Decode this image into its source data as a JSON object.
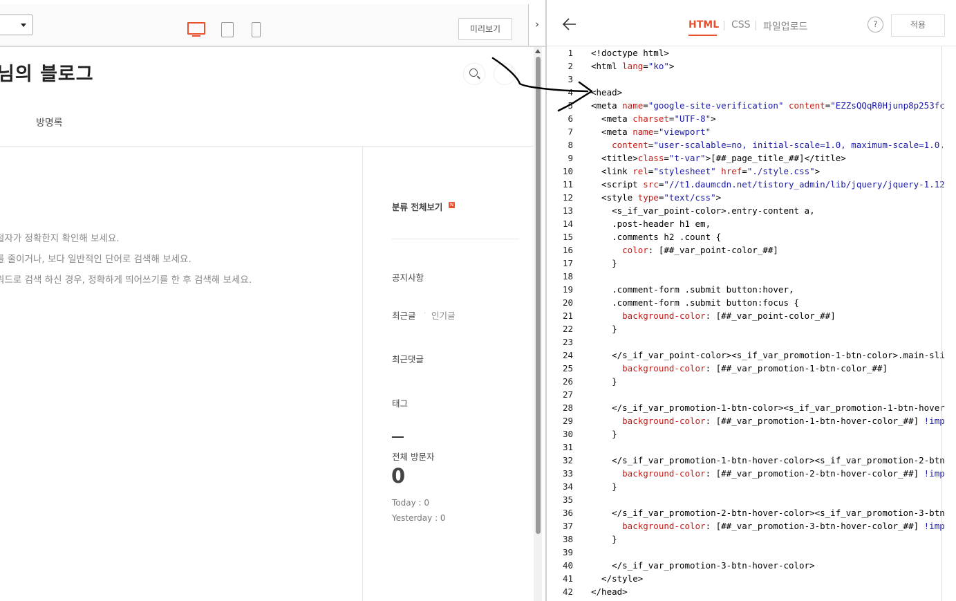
{
  "left_toolbar": {
    "preview_label": "미리보기",
    "collapse_glyph": "›",
    "device_icons": [
      "pc-icon",
      "tablet-icon",
      "mobile-icon"
    ]
  },
  "blog": {
    "title": "님의 블로그",
    "nav_guestbook": "방명록",
    "search_hints": [
      "철자가 정확한지 확인해 보세요.",
      "를 줄이거나, 보다 일반적인 단어로 검색해 보세요.",
      "워드로 검색 하신 경우, 정확하게 띄어쓰기를 한 후 검색해 보세요."
    ],
    "sidebar": {
      "category_all": "분류 전체보기",
      "new_badge": "N",
      "notice": "공지사항",
      "recent_posts": "최근글",
      "popular_posts": "인기글",
      "separator_dot": "·",
      "recent_comments": "최근댓글",
      "tags": "태그",
      "total_visitors_label": "전체 방문자",
      "total_visitors_value": "0",
      "today": "Today : 0",
      "yesterday": "Yesterday : 0"
    }
  },
  "editor": {
    "tabs": [
      "HTML",
      "CSS",
      "파일업로드"
    ],
    "active_tab": "HTML",
    "help_glyph": "?",
    "apply_label": "적용",
    "accent_color": "#e8502e",
    "line_numbers": [
      "1",
      "2",
      "3",
      "4",
      "5",
      "6",
      "7",
      "8",
      "9",
      "10",
      "11",
      "12",
      "13",
      "14",
      "15",
      "16",
      "17",
      "18",
      "19",
      "20",
      "21",
      "22",
      "23",
      "24",
      "25",
      "26",
      "27",
      "28",
      "29",
      "30",
      "31",
      "32",
      "33",
      "34",
      "35",
      "36",
      "37",
      "38",
      "39",
      "40",
      "41",
      "42"
    ],
    "code": [
      "<!doctype html>",
      "<html lang=\"ko\">",
      "",
      "<head>",
      "<meta name=\"google-site-verification\" content=\"EZZsQQqR0Hjunp8p253fc",
      "  <meta charset=\"UTF-8\">",
      "  <meta name=\"viewport\"",
      "    content=\"user-scalable=no, initial-scale=1.0, maximum-scale=1.0,",
      "  <title>[##_page_title_##]</title>",
      "  <link rel=\"stylesheet\" href=\"./style.css\">",
      "  <script src=\"//t1.daumcdn.net/tistory_admin/lib/jquery/jquery-1.12",
      "  <style type=\"text/css\">",
      "    <s_if_var_point-color>.entry-content a,",
      "    .post-header h1 em,",
      "    .comments h2 .count {",
      "      color: [##_var_point-color_##]",
      "    }",
      "",
      "    .comment-form .submit button:hover,",
      "    .comment-form .submit button:focus {",
      "      background-color: [##_var_point-color_##]",
      "    }",
      "",
      "    </s_if_var_point-color><s_if_var_promotion-1-btn-color>.main-sli",
      "      background-color: [##_var_promotion-1-btn-color_##]",
      "    }",
      "",
      "    </s_if_var_promotion-1-btn-color><s_if_var_promotion-1-btn-hover",
      "      background-color: [##_var_promotion-1-btn-hover-color_##] !imp",
      "    }",
      "",
      "    </s_if_var_promotion-1-btn-hover-color><s_if_var_promotion-2-btn",
      "      background-color: [##_var_promotion-2-btn-hover-color_##] !imp",
      "    }",
      "",
      "    </s_if_var_promotion-2-btn-hover-color><s_if_var_promotion-3-btn",
      "      background-color: [##_var_promotion-3-btn-hover-color_##] !imp",
      "    }",
      "",
      "    </s_if_var_promotion-3-btn-hover-color>",
      "  </style>",
      "</head>"
    ]
  }
}
